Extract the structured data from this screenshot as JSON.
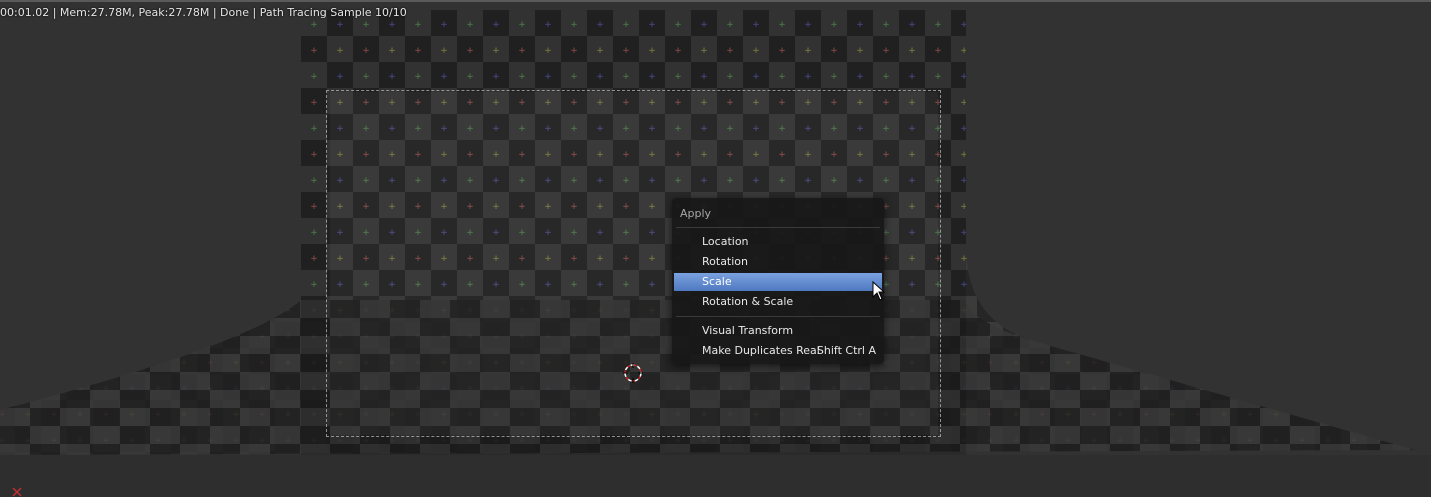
{
  "status_bar": {
    "text": "00:01.02 | Mem:27.78M, Peak:27.78M | Done | Path Tracing Sample 10/10"
  },
  "apply_menu": {
    "title": "Apply",
    "items": [
      {
        "label": "Location",
        "shortcut": ""
      },
      {
        "label": "Rotation",
        "shortcut": ""
      },
      {
        "label": "Scale",
        "shortcut": "",
        "highlighted": true
      },
      {
        "label": "Rotation & Scale",
        "shortcut": ""
      },
      {
        "label": "Visual Transform",
        "shortcut": ""
      },
      {
        "label": "Make Duplicates Real",
        "shortcut": "Shift Ctrl A"
      }
    ]
  },
  "icons": {
    "cursor_3d": "3d-cursor-icon",
    "mouse_pointer": "mouse-pointer-icon",
    "axis_marker": "axis-x-icon"
  },
  "colors": {
    "highlight_top": "#7aa2e0",
    "highlight_bottom": "#4f78c0",
    "menu_bg": "#181818",
    "viewport_bg": "#323232"
  }
}
